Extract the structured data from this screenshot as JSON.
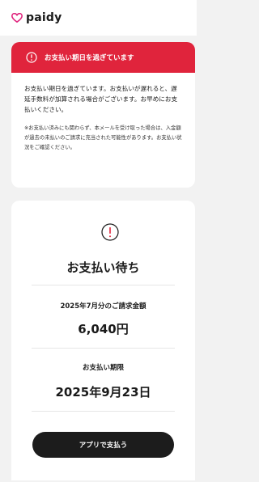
{
  "brand": {
    "name": "paidy",
    "accent": "#e0243c"
  },
  "alert": {
    "icon": "exclamation-circle-icon",
    "title": "お支払い期日を過ぎています",
    "message": "お支払い期日を過ぎています。お支払いが遅れると、遅延手数料が加算される場合がございます。お早めにお支払いください。",
    "note": "※お支払い済みにも関わらず、本メールを受け取った場合は、入金額が過去の未払いのご請求に充当された可能性があります。お支払い状況をご確認ください。"
  },
  "status": {
    "icon": "exclamation-circle-icon",
    "title": "お支払い待ち",
    "amount_label": "2025年7月分のご請求金額",
    "amount_value": "6,040円",
    "due_label": "お支払い期限",
    "due_value": "2025年9月23日"
  },
  "action": {
    "pay_button": "アプリで支払う"
  }
}
